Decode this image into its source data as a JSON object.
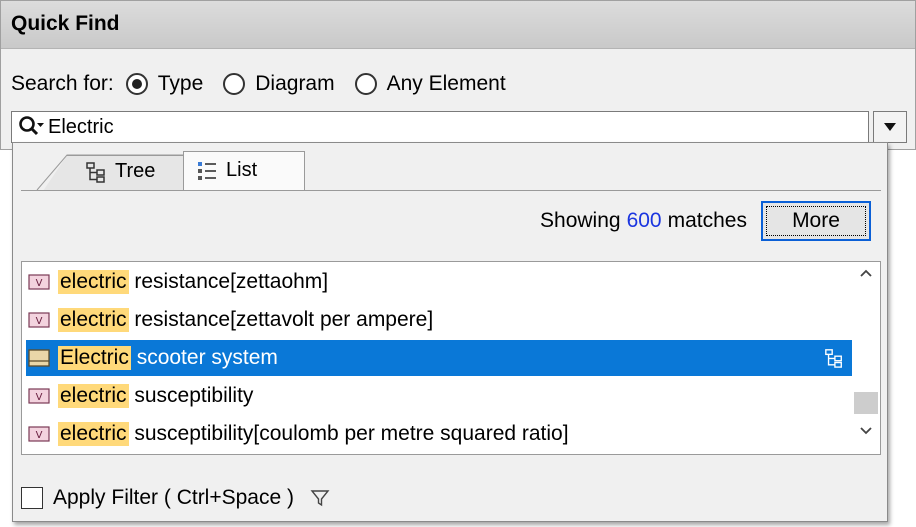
{
  "window": {
    "title": "Quick Find"
  },
  "search": {
    "label": "Search for:",
    "options": [
      {
        "label": "Type",
        "selected": true
      },
      {
        "label": "Diagram",
        "selected": false
      },
      {
        "label": "Any Element",
        "selected": false
      }
    ],
    "value": "Electric"
  },
  "tabs": [
    {
      "label": "Tree",
      "active": false
    },
    {
      "label": "List",
      "active": true
    }
  ],
  "matches": {
    "prefix": "Showing",
    "count": "600",
    "suffix": "matches",
    "more_label": "More"
  },
  "results": [
    {
      "highlight": "electric",
      "rest": " resistance[zettaohm]",
      "icon": "value-type-icon",
      "selected": false
    },
    {
      "highlight": "electric",
      "rest": " resistance[zettavolt per ampere]",
      "icon": "value-type-icon",
      "selected": false
    },
    {
      "highlight": "Electric",
      "rest": " scooter system",
      "icon": "block-icon",
      "selected": true
    },
    {
      "highlight": "electric",
      "rest": " susceptibility",
      "icon": "value-type-icon",
      "selected": false
    },
    {
      "highlight": "electric",
      "rest": " susceptibility[coulomb per metre squared ratio]",
      "icon": "value-type-icon",
      "selected": false
    }
  ],
  "filter": {
    "label": "Apply Filter ( Ctrl+Space )",
    "checked": false
  },
  "colors": {
    "selection": "#0a78d7",
    "highlight": "#ffd97a",
    "count": "#1a35e0"
  }
}
